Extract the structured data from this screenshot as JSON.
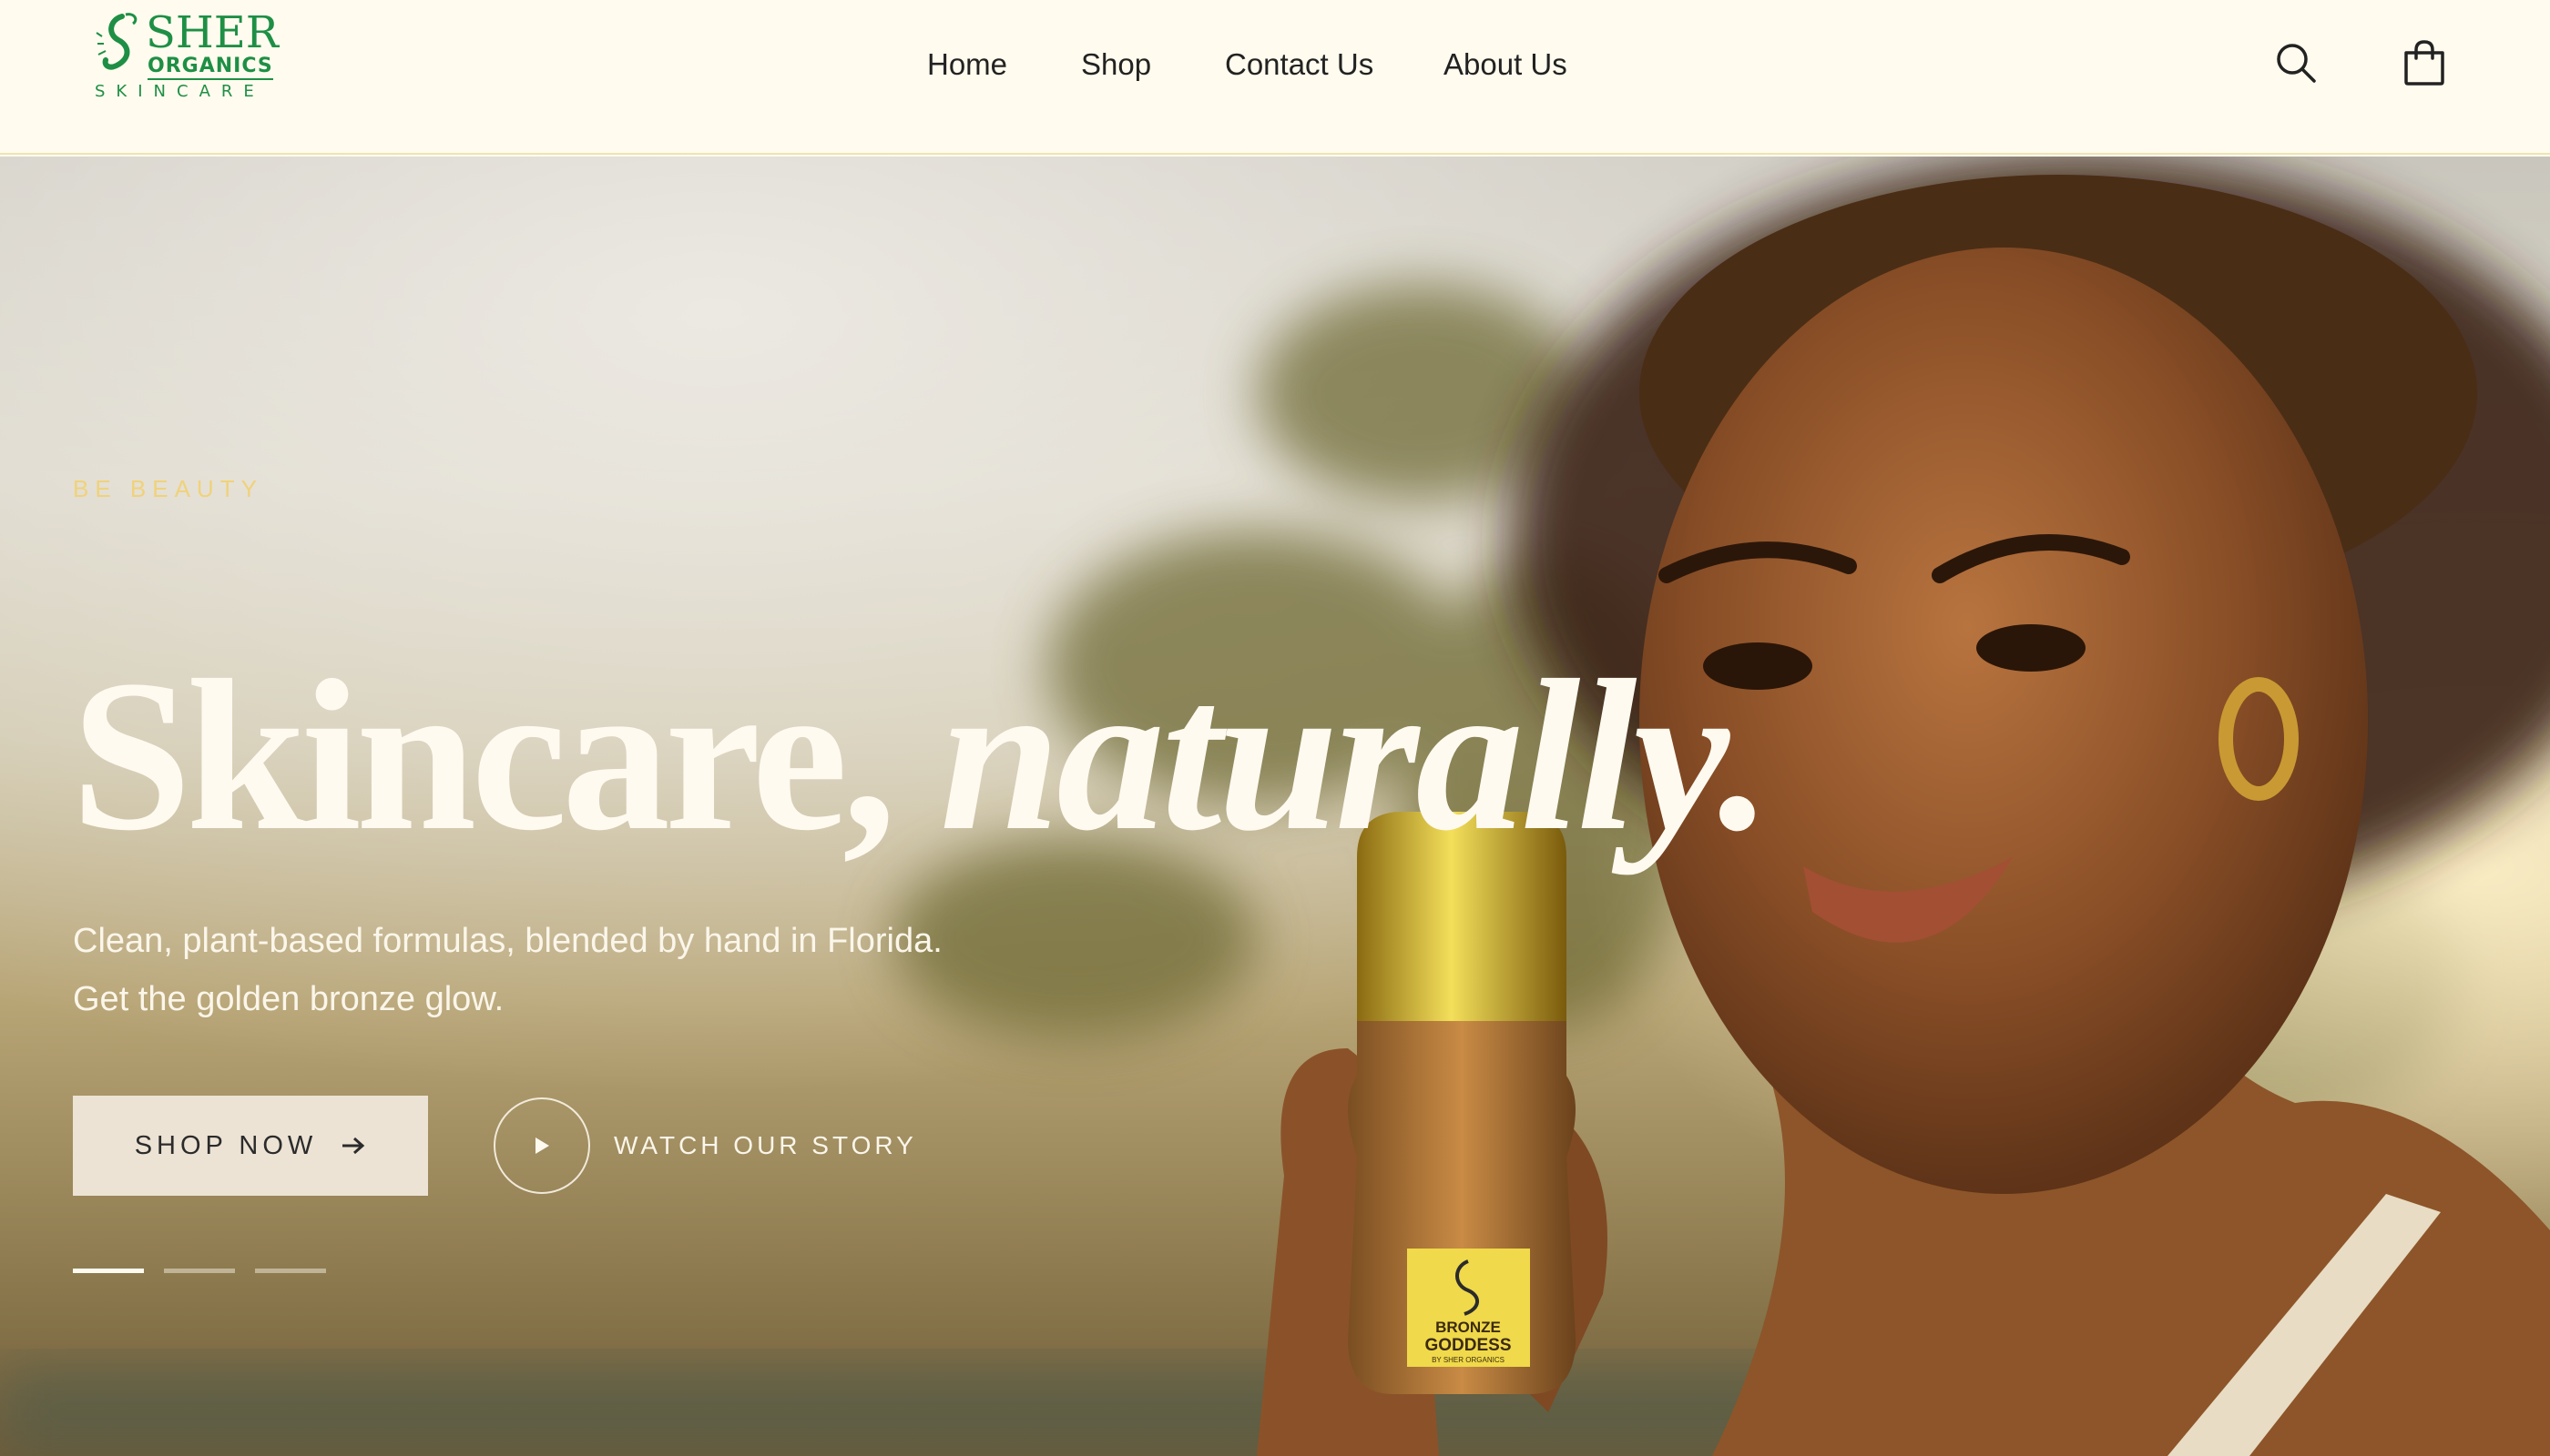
{
  "brand": {
    "name_line1": "SHER",
    "name_line2": "ORGANICS",
    "name_line3": "SKINCARE",
    "color": "#1e8f45"
  },
  "nav": {
    "items": [
      {
        "label": "Home"
      },
      {
        "label": "Shop"
      },
      {
        "label": "Contact Us"
      },
      {
        "label": "About Us"
      }
    ]
  },
  "header_icons": {
    "search": "search-icon",
    "cart": "cart-icon"
  },
  "hero": {
    "eyebrow": "BE BEAUTY",
    "headline_regular": "Skincare,",
    "headline_italic": "naturally.",
    "subcopy": "Clean, plant-based formulas, blended by hand in Florida. Get the golden bronze glow.",
    "primary_cta": "SHOP NOW",
    "secondary_cta": "WATCH OUR STORY",
    "slides_total": 3,
    "active_slide": 1,
    "product_label_line1": "BRONZE",
    "product_label_line2": "GODDESS",
    "product_label_line3": "BY SHER ORGANICS"
  },
  "colors": {
    "header_bg": "#fffbee",
    "eyebrow": "#f0d27a",
    "headline": "#fffaf0",
    "cta_bg": "#ece3d4"
  }
}
